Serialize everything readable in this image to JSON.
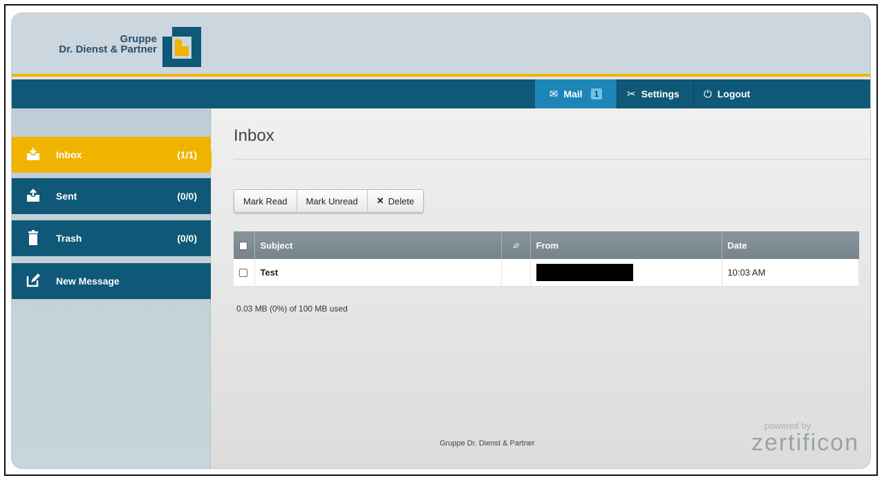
{
  "brand": {
    "line1": "Gruppe",
    "line2": "Dr. Dienst & Partner",
    "colors": {
      "navy": "#0f5877",
      "gold": "#f0b400",
      "header_bg": "#cbd6de"
    }
  },
  "nav": {
    "mail_label": "Mail",
    "mail_badge": "1",
    "settings_label": "Settings",
    "logout_label": "Logout"
  },
  "sidebar": {
    "items": [
      {
        "label": "Inbox",
        "count": "(1/1)",
        "icon": "inbox-icon",
        "active": true
      },
      {
        "label": "Sent",
        "count": "(0/0)",
        "icon": "sent-icon",
        "active": false
      },
      {
        "label": "Trash",
        "count": "(0/0)",
        "icon": "trash-icon",
        "active": false
      },
      {
        "label": "New Message",
        "count": "",
        "icon": "compose-icon",
        "active": false
      }
    ]
  },
  "main": {
    "title": "Inbox",
    "toolbar": {
      "mark_read": "Mark Read",
      "mark_unread": "Mark Unread",
      "delete": "Delete"
    },
    "table": {
      "columns": [
        "Subject",
        "From",
        "Date"
      ],
      "rows": [
        {
          "subject": "Test",
          "from": "",
          "date": "10:03 AM"
        }
      ]
    },
    "quota": "0.03 MB (0%) of 100 MB used",
    "footer": "Gruppe Dr. Dienst & Partner",
    "powered_by": "powered by",
    "powered_brand": "zertificon"
  }
}
